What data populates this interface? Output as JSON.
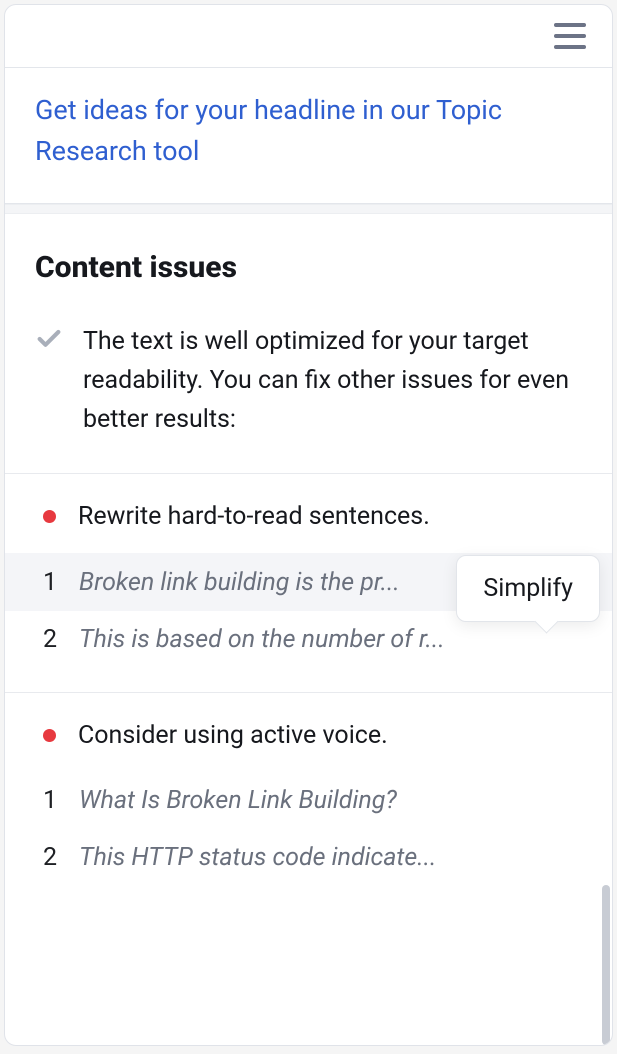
{
  "link": {
    "text": "Get ideas for your headline in our Topic Research tool"
  },
  "contentIssues": {
    "title": "Content issues",
    "intro": "The text is well optimized for your target readability. You can fix other issues for even better results:",
    "tooltip": "Simplify",
    "groups": [
      {
        "title": "Rewrite hard-to-read sentences.",
        "items": [
          {
            "num": "1",
            "text": "Broken link building is the pr...",
            "hasAction": true
          },
          {
            "num": "2",
            "text": "This is based on the number of r..."
          }
        ]
      },
      {
        "title": "Consider using active voice.",
        "items": [
          {
            "num": "1",
            "text": "What Is Broken Link Building?"
          },
          {
            "num": "2",
            "text": "This HTTP status code indicate..."
          }
        ]
      }
    ]
  }
}
